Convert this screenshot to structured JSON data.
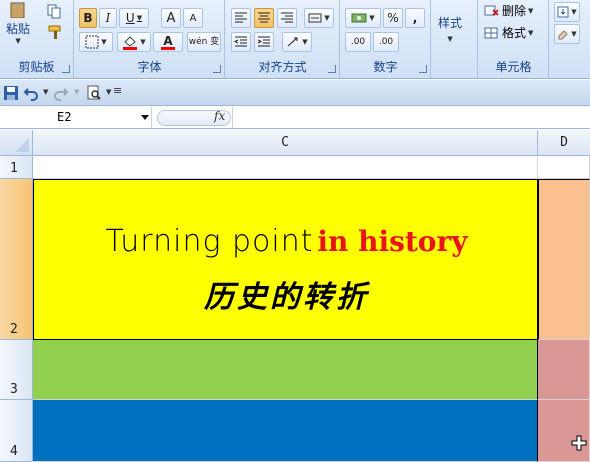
{
  "ribbon": {
    "clipboard": {
      "paste_label": "粘贴",
      "group_label": "剪贴板"
    },
    "font": {
      "bold": "B",
      "italic": "I",
      "underline": "U",
      "grow": "A",
      "shrink": "A",
      "font_color": "A",
      "phonetic": "wén 变",
      "group_label": "字体"
    },
    "align": {
      "group_label": "对齐方式"
    },
    "number": {
      "percent": "%",
      "comma": ",",
      "inc_decimal": ".00",
      "dec_decimal": ".00",
      "group_label": "数字"
    },
    "styles": {
      "label": "样式"
    },
    "cells": {
      "delete_label": "删除",
      "format_label": "格式",
      "group_label": "单元格"
    }
  },
  "formula_bar": {
    "name_box": "E2",
    "fx_label": "fx",
    "formula": ""
  },
  "sheet": {
    "columns": [
      "C",
      "D"
    ],
    "rows": [
      "1",
      "2",
      "3",
      "4"
    ],
    "title_part1": "Turning point",
    "title_part2": "in history",
    "title_zh": "历史的转折"
  },
  "colors": {
    "row2_fill": "#ffff00",
    "row3_fill": "#92d050",
    "row4_fill": "#0070c0",
    "d2_fill": "#fac090",
    "d3_fill": "#d99795",
    "accent_red": "#e8141b"
  }
}
